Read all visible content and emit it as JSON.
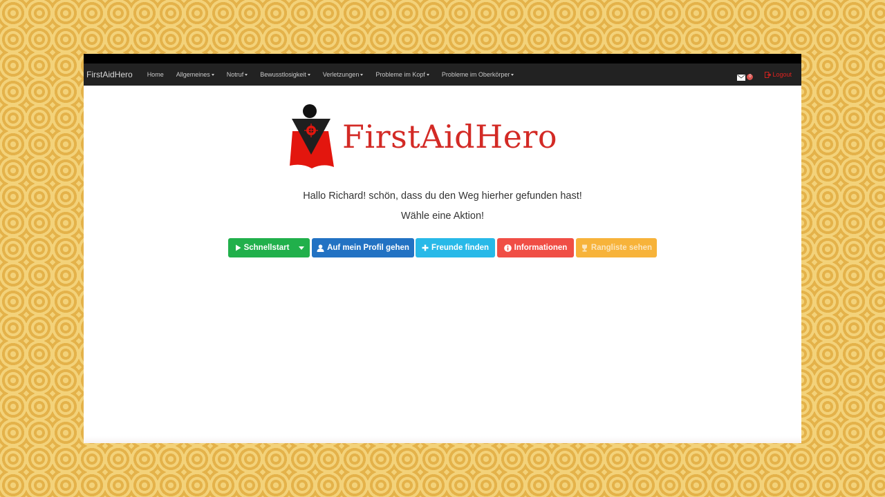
{
  "navbar": {
    "brand": "FirstAidHero",
    "items": [
      {
        "label": "Home",
        "dropdown": false
      },
      {
        "label": "Allgemeines",
        "dropdown": true
      },
      {
        "label": "Notruf",
        "dropdown": true
      },
      {
        "label": "Bewusstlosigkeit",
        "dropdown": true
      },
      {
        "label": "Verletzungen",
        "dropdown": true
      },
      {
        "label": "Probleme im Kopf",
        "dropdown": true
      },
      {
        "label": "Probleme im Oberkörper",
        "dropdown": true
      }
    ],
    "mail_badge": "0",
    "logout": "Logout"
  },
  "logo": {
    "text": "FirstAidHero"
  },
  "main": {
    "greeting": "Hallo Richard! schön, dass du den Weg hierher gefunden hast!",
    "prompt": "Wähle eine Aktion!"
  },
  "actions": {
    "schnellstart": "Schnellstart",
    "profil": "Auf mein Profil gehen",
    "freunde": "Freunde finden",
    "informationen": "Informationen",
    "rangliste": "Rangliste sehen"
  },
  "colors": {
    "navbar_bg": "#222222",
    "brand_red": "#d32a25",
    "success": "#21b04b",
    "primary": "#2272c3",
    "info": "#28b9e8",
    "danger": "#f04e45",
    "warning": "#f7b33a"
  },
  "icons": {
    "mail": "envelope-icon",
    "logout": "logout-icon",
    "schnellstart": "play-icon",
    "profil": "user-icon",
    "freunde": "plus-icon",
    "informationen": "info-icon",
    "rangliste": "trophy-icon"
  }
}
